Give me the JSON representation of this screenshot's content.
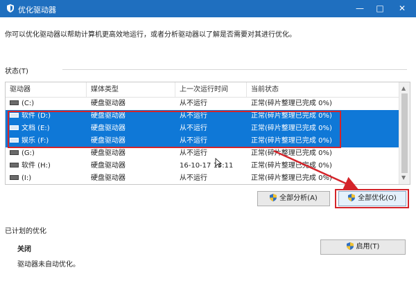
{
  "window": {
    "title": "优化驱动器"
  },
  "description": "你可以优化驱动器以帮助计算机更高效地运行，或者分析驱动器以了解是否需要对其进行优化。",
  "status": {
    "label": "状态(T)"
  },
  "grid": {
    "headers": [
      "驱动器",
      "媒体类型",
      "上一次运行时间",
      "当前状态"
    ],
    "rows": [
      {
        "drive": "(C:)",
        "media": "硬盘驱动器",
        "last_run": "从不运行",
        "status": "正常(碎片整理已完成 0%)",
        "selected": false
      },
      {
        "drive": "软件 (D:)",
        "media": "硬盘驱动器",
        "last_run": "从不运行",
        "status": "正常(碎片整理已完成 0%)",
        "selected": true
      },
      {
        "drive": "文档 (E:)",
        "media": "硬盘驱动器",
        "last_run": "从不运行",
        "status": "正常(碎片整理已完成 0%)",
        "selected": true
      },
      {
        "drive": "娱乐 (F:)",
        "media": "硬盘驱动器",
        "last_run": "从不运行",
        "status": "正常(碎片整理已完成 0%)",
        "selected": true
      },
      {
        "drive": "(G:)",
        "media": "硬盘驱动器",
        "last_run": "从不运行",
        "status": "正常(碎片整理已完成 0%)",
        "selected": false
      },
      {
        "drive": "软件 (H:)",
        "media": "硬盘驱动器",
        "last_run": "16-10-17 15:11",
        "status": "正常(碎片整理已完成 0%)",
        "selected": false
      },
      {
        "drive": "(I:)",
        "media": "硬盘驱动器",
        "last_run": "从不运行",
        "status": "正常(碎片整理已完成 0%)",
        "selected": false
      }
    ]
  },
  "buttons": {
    "analyze_all": "全部分析(A)",
    "optimize_all": "全部优化(O)",
    "enable": "启用(T)"
  },
  "scheduled": {
    "title": "已计划的优化",
    "state": "关闭",
    "description": "驱动器未自动优化。"
  },
  "colors": {
    "titlebar": "#1f6fbf",
    "selection": "#0f78d7",
    "annotation": "#d4242a"
  }
}
